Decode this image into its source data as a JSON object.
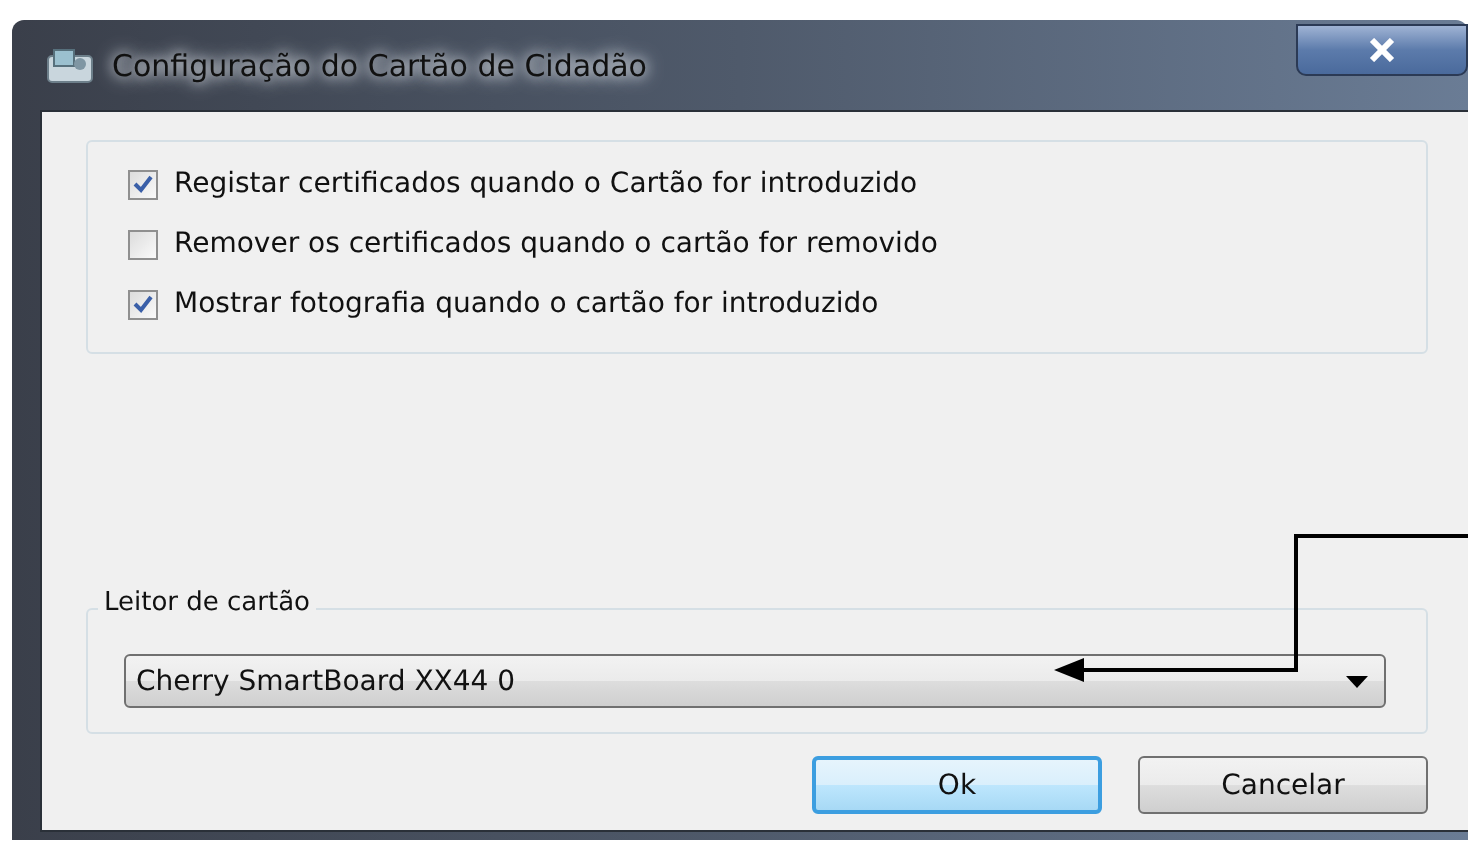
{
  "window": {
    "title": "Configuração do Cartão de Cidadão"
  },
  "options": [
    {
      "label": "Registar certificados quando o Cartão for introduzido",
      "checked": true
    },
    {
      "label": "Remover os certificados quando o cartão for removido",
      "checked": false
    },
    {
      "label": "Mostrar fotografia quando o cartão for introduzido",
      "checked": true
    }
  ],
  "reader_group": {
    "label": "Leitor de cartão",
    "value": "Cherry SmartBoard XX44 0"
  },
  "buttons": [
    {
      "label": "Ok",
      "default": true
    },
    {
      "label": "Cancelar",
      "default": false
    }
  ]
}
